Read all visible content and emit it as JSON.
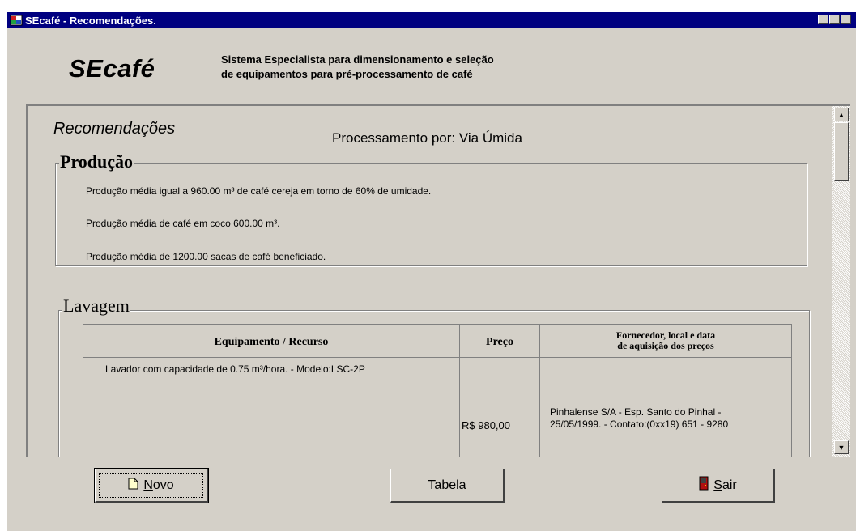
{
  "window": {
    "title": "SEcafé -  Recomendações."
  },
  "header": {
    "logo": "SEcafé",
    "description_line1": "Sistema Especialista para dimensionamento e seleção",
    "description_line2": "de equipamentos para pré-processamento de café"
  },
  "report": {
    "heading": "Recomendações",
    "processing": "Processamento por: Via Úmida",
    "producao": {
      "legend": "Produção",
      "lines": [
        "Produção média igual a 960.00  m³ de café cereja em torno de 60% de umidade.",
        "Produção média de café em coco 600.00  m³.",
        "Produção média de 1200.00  sacas de café beneficiado."
      ]
    },
    "lavagem": {
      "legend": "Lavagem",
      "columns": [
        "Equipamento / Recurso",
        "Preço",
        "Fornecedor, local e data",
        "de aquisição dos preços"
      ],
      "rows": [
        {
          "equipment": "Lavador com capacidade de 0.75  m³/hora.  - Modelo:LSC-2P",
          "price": "R$ 980,00",
          "supplier_line1": "Pinhalense S/A - Esp. Santo do Pinhal -",
          "supplier_line2": "25/05/1999.  - Contato:(0xx19) 651 - 9280"
        }
      ]
    }
  },
  "buttons": {
    "novo": {
      "prefix": "",
      "accel": "N",
      "rest": "ovo"
    },
    "tabela": "Tabela",
    "sair": {
      "accel": "S",
      "rest": "air"
    }
  },
  "colors": {
    "titlebar": "#000080",
    "face": "#d4d0c8"
  },
  "icons": [
    "app-icon",
    "new-document-icon",
    "exit-door-icon",
    "minimize-icon",
    "maximize-icon",
    "close-icon",
    "scroll-up-arrow-icon",
    "scroll-down-arrow-icon"
  ]
}
